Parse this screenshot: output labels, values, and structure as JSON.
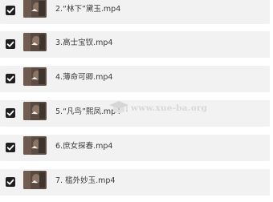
{
  "files": [
    {
      "name": "2.“林下”黛玉.mp4",
      "checked": true
    },
    {
      "name": "3.高士宝钗.mp4",
      "checked": true
    },
    {
      "name": "4.薄命可卿.mp4",
      "checked": true
    },
    {
      "name": "5.“凡鸟”熙凤.mp4",
      "checked": true
    },
    {
      "name": "6.庶女探春.mp4",
      "checked": true
    },
    {
      "name": "7. 槛外妙玉.mp4",
      "checked": true
    }
  ],
  "watermark": {
    "text": "www.xue-ba.org",
    "icon": "graduation-cap-icon"
  },
  "colors": {
    "row_bg": "#f2f2f2",
    "checkbox": "#1f1f1f",
    "text": "#3a3a3a",
    "watermark": "#d8d8d8"
  }
}
